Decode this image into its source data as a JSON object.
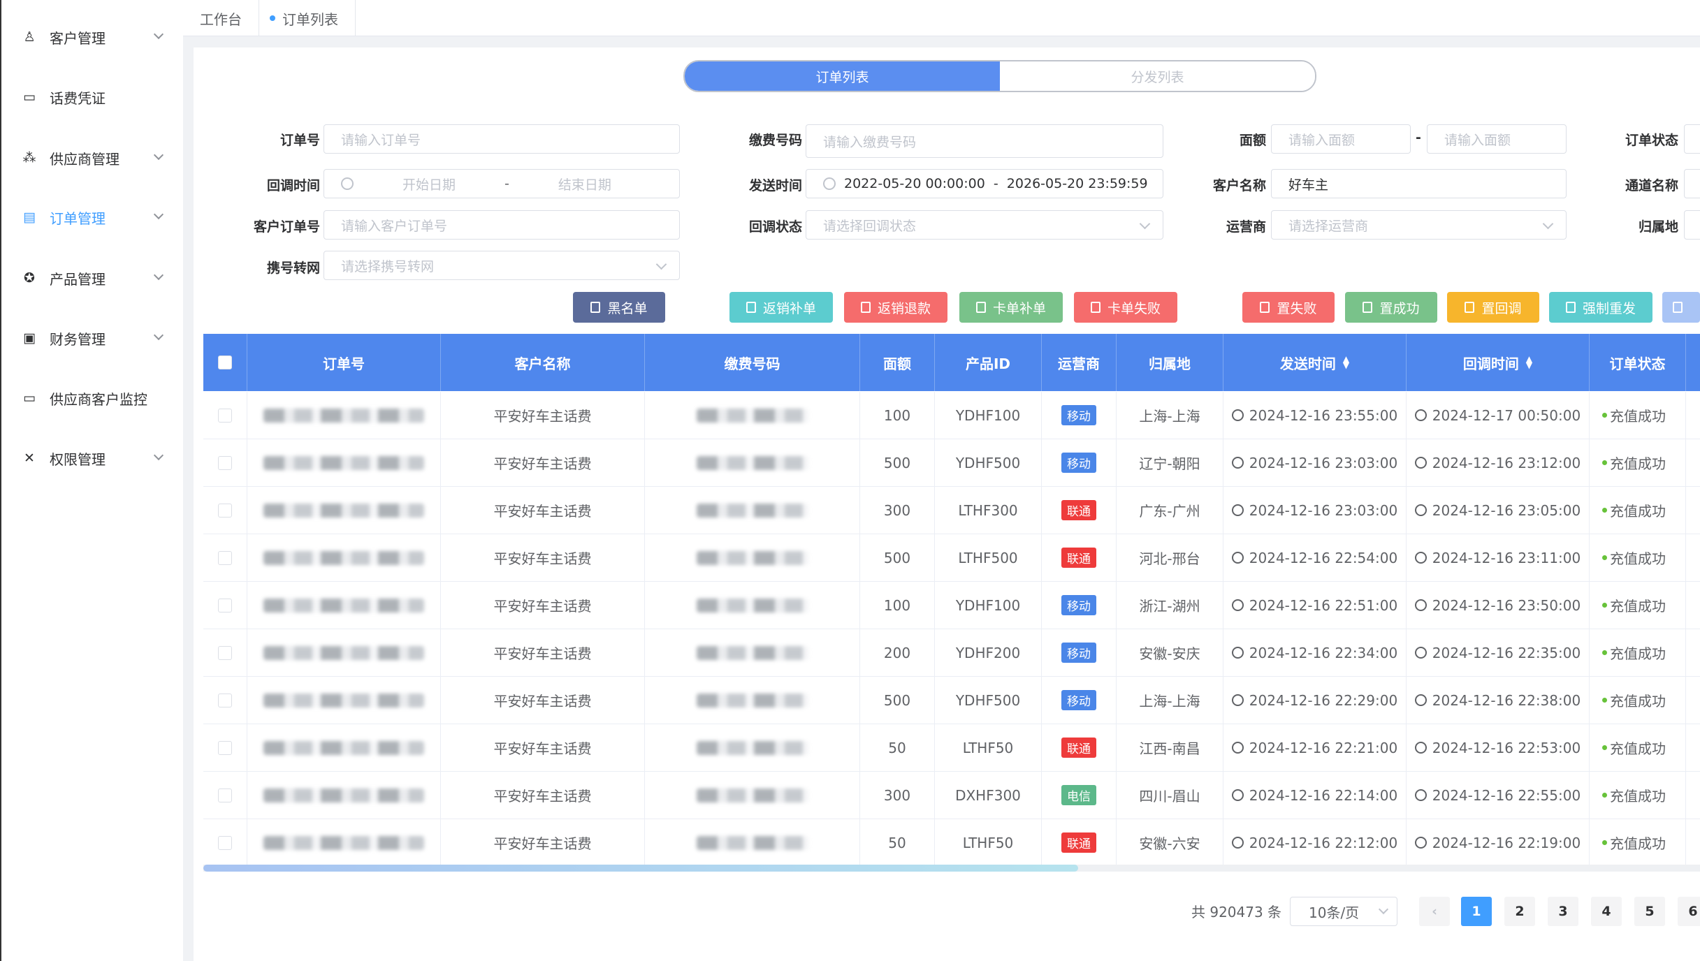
{
  "sidebar": {
    "items": [
      {
        "label": "客户管理",
        "icon": "user-icon",
        "glyph": "♙",
        "has_children": true
      },
      {
        "label": "话费凭证",
        "icon": "voucher-icon",
        "glyph": "▭",
        "has_children": false
      },
      {
        "label": "供应商管理",
        "icon": "supplier-icon",
        "glyph": "⁂",
        "has_children": true
      },
      {
        "label": "订单管理",
        "icon": "order-icon",
        "glyph": "▤",
        "has_children": true,
        "active": true
      },
      {
        "label": "产品管理",
        "icon": "product-icon",
        "glyph": "✪",
        "has_children": true
      },
      {
        "label": "财务管理",
        "icon": "finance-icon",
        "glyph": "▣",
        "has_children": true
      },
      {
        "label": "供应商客户监控",
        "icon": "monitor-icon",
        "glyph": "▭",
        "has_children": false
      },
      {
        "label": "权限管理",
        "icon": "permission-icon",
        "glyph": "✕",
        "has_children": true
      }
    ]
  },
  "tabs": {
    "workbench": "工作台",
    "order_list": "订单列表"
  },
  "segment": {
    "order_list": "订单列表",
    "dispatch_list": "分发列表"
  },
  "filters": {
    "order_no": {
      "label": "订单号",
      "placeholder": "请输入订单号"
    },
    "callback_time": {
      "label": "回调时间",
      "start": "开始日期",
      "sep": "-",
      "end": "结束日期"
    },
    "customer_order_no": {
      "label": "客户订单号",
      "placeholder": "请输入客户订单号"
    },
    "port_transfer": {
      "label": "携号转网",
      "placeholder": "请选择携号转网"
    },
    "pay_number": {
      "label": "缴费号码",
      "placeholder": "请输入缴费号码"
    },
    "send_time": {
      "label": "发送时间",
      "value": "2022-05-20 00:00:00  -  2026-05-20 23:59:59"
    },
    "callback_status": {
      "label": "回调状态",
      "placeholder": "请选择回调状态"
    },
    "denomination": {
      "label": "面额",
      "placeholder_min": "请输入面额",
      "sep": "-",
      "placeholder_max": "请输入面额"
    },
    "customer_name": {
      "label": "客户名称",
      "value": "好车主"
    },
    "carrier": {
      "label": "运营商",
      "placeholder": "请选择运营商"
    },
    "order_status": {
      "label": "订单状态"
    },
    "channel_name": {
      "label": "通道名称"
    },
    "region": {
      "label": "归属地"
    }
  },
  "buttons": {
    "blacklist": "黑名单",
    "reversal_refill": "返销补单",
    "reversal_refund": "返销退款",
    "stuck_refill": "卡单补单",
    "stuck_fail": "卡单失败",
    "set_fail": "置失败",
    "set_success": "置成功",
    "set_callback": "置回调",
    "force_resend": "强制重发"
  },
  "colors": {
    "primary": "#409eff",
    "header": "#4f87ed",
    "blacklist": "#5b6b9a",
    "teal": "#5ccccf",
    "red": "#f56c6c",
    "green": "#79c28a",
    "orange": "#f7b52c",
    "mobile": "#4a86e8",
    "unicom": "#ee3b3b",
    "telecom": "#5cb88a"
  },
  "table": {
    "headers": {
      "order_no": "订单号",
      "customer": "客户名称",
      "pay_no": "缴费号码",
      "amount": "面额",
      "product_id": "产品ID",
      "carrier": "运营商",
      "region": "归属地",
      "send_time": "发送时间",
      "callback_time": "回调时间",
      "status": "订单状态"
    },
    "rows": [
      {
        "customer": "平安好车主话费",
        "amount": "100",
        "product": "YDHF100",
        "carrier": "移动",
        "carrier_type": "mobile",
        "region": "上海-上海",
        "send": "2024-12-16 23:55:00",
        "callback": "2024-12-17 00:50:00",
        "status": "充值成功"
      },
      {
        "customer": "平安好车主话费",
        "amount": "500",
        "product": "YDHF500",
        "carrier": "移动",
        "carrier_type": "mobile",
        "region": "辽宁-朝阳",
        "send": "2024-12-16 23:03:00",
        "callback": "2024-12-16 23:12:00",
        "status": "充值成功"
      },
      {
        "customer": "平安好车主话费",
        "amount": "300",
        "product": "LTHF300",
        "carrier": "联通",
        "carrier_type": "unicom",
        "region": "广东-广州",
        "send": "2024-12-16 23:03:00",
        "callback": "2024-12-16 23:05:00",
        "status": "充值成功"
      },
      {
        "customer": "平安好车主话费",
        "amount": "500",
        "product": "LTHF500",
        "carrier": "联通",
        "carrier_type": "unicom",
        "region": "河北-邢台",
        "send": "2024-12-16 22:54:00",
        "callback": "2024-12-16 23:11:00",
        "status": "充值成功"
      },
      {
        "customer": "平安好车主话费",
        "amount": "100",
        "product": "YDHF100",
        "carrier": "移动",
        "carrier_type": "mobile",
        "region": "浙江-湖州",
        "send": "2024-12-16 22:51:00",
        "callback": "2024-12-16 23:50:00",
        "status": "充值成功"
      },
      {
        "customer": "平安好车主话费",
        "amount": "200",
        "product": "YDHF200",
        "carrier": "移动",
        "carrier_type": "mobile",
        "region": "安徽-安庆",
        "send": "2024-12-16 22:34:00",
        "callback": "2024-12-16 22:35:00",
        "status": "充值成功"
      },
      {
        "customer": "平安好车主话费",
        "amount": "500",
        "product": "YDHF500",
        "carrier": "移动",
        "carrier_type": "mobile",
        "region": "上海-上海",
        "send": "2024-12-16 22:29:00",
        "callback": "2024-12-16 22:38:00",
        "status": "充值成功"
      },
      {
        "customer": "平安好车主话费",
        "amount": "50",
        "product": "LTHF50",
        "carrier": "联通",
        "carrier_type": "unicom",
        "region": "江西-南昌",
        "send": "2024-12-16 22:21:00",
        "callback": "2024-12-16 22:53:00",
        "status": "充值成功"
      },
      {
        "customer": "平安好车主话费",
        "amount": "300",
        "product": "DXHF300",
        "carrier": "电信",
        "carrier_type": "telecom",
        "region": "四川-眉山",
        "send": "2024-12-16 22:14:00",
        "callback": "2024-12-16 22:55:00",
        "status": "充值成功"
      },
      {
        "customer": "平安好车主话费",
        "amount": "50",
        "product": "LTHF50",
        "carrier": "联通",
        "carrier_type": "unicom",
        "region": "安徽-六安",
        "send": "2024-12-16 22:12:00",
        "callback": "2024-12-16 22:19:00",
        "status": "充值成功"
      }
    ]
  },
  "pagination": {
    "total": "共 920473 条",
    "page_size": "10条/页",
    "pages": [
      "1",
      "2",
      "3",
      "4",
      "5",
      "6"
    ],
    "current": "1"
  }
}
